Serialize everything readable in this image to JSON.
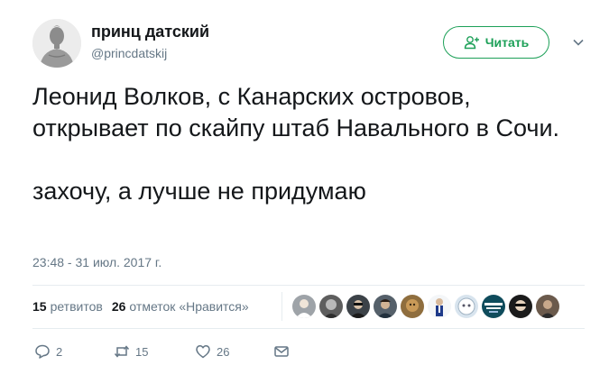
{
  "author": {
    "display_name": "принц датский",
    "handle": "@princdatskij"
  },
  "follow_button": {
    "label": "Читать"
  },
  "tweet": {
    "text": "Леонид Волков, с Канарских островов, открывает по скайпу штаб Навального в Сочи.\n\nзахочу, а лучше не придумаю",
    "timestamp": "23:48 - 31 июл. 2017 г."
  },
  "stats": {
    "retweets_count": "15",
    "retweets_label": "ретвитов",
    "likes_count": "26",
    "likes_label": "отметок «Нравится»"
  },
  "liker_avatars": [
    "avatar-1",
    "avatar-2",
    "avatar-3",
    "avatar-4",
    "avatar-5",
    "avatar-6",
    "avatar-7",
    "avatar-8",
    "avatar-9",
    "avatar-10"
  ],
  "actions": {
    "reply_count": "2",
    "retweet_count": "15",
    "like_count": "26"
  },
  "colors": {
    "accent": "#1da058",
    "text": "#14171a",
    "muted": "#657786",
    "divider": "#e6ecf0"
  }
}
